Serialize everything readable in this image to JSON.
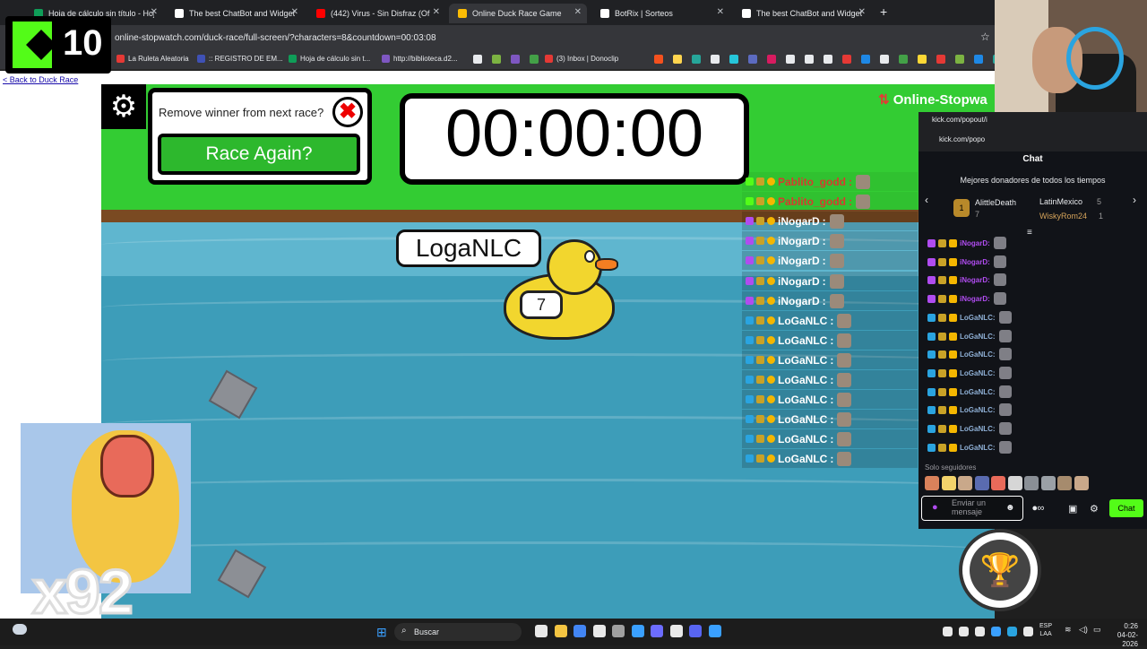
{
  "browser": {
    "tabs": [
      {
        "label": "Hoja de cálculo sin título - Hoja",
        "color": "#0f9d58",
        "active": false
      },
      {
        "label": "The best ChatBot and Widgets",
        "color": "#ffffff",
        "active": false
      },
      {
        "label": "(442) Virus - Sin Disfraz (Of",
        "color": "#ff0000",
        "active": false
      },
      {
        "label": "Online Duck Race Game",
        "color": "#fbbc04",
        "active": true
      },
      {
        "label": "BotRix | Sorteos",
        "color": "#ffffff",
        "active": false
      },
      {
        "label": "The best ChatBot and Widgets",
        "color": "#ffffff",
        "active": false
      }
    ],
    "new_tab": "+",
    "url": "online-stopwatch.com/duck-race/full-screen/?characters=8&countdown=00:03:08",
    "star": "☆",
    "bookmarks": [
      {
        "label": "La Ruleta Aleatoria",
        "color": "#e53935"
      },
      {
        "label": ":: REGISTRO DE EM...",
        "color": "#3f51b5"
      },
      {
        "label": "Hoja de cálculo sin t...",
        "color": "#0f9d58"
      },
      {
        "label": "http://biblioteca.d2...",
        "color": "#7e57c2"
      },
      {
        "label": "(3) Inbox | Donoclip",
        "color": "#e53935"
      }
    ]
  },
  "overlay": {
    "kick_number": "10",
    "multiplier": "x92"
  },
  "page": {
    "back_link": "< Back to Duck Race"
  },
  "race": {
    "remove_winner_label": "Remove winner from next race?",
    "close_icon": "✖",
    "race_again_label": "Race Again?",
    "timer": "00:00:00",
    "brand": "Online-Stopwa",
    "duck_name": "LogaNLC",
    "duck_number": "7",
    "leaderboard": [
      {
        "name": "Pablito_godd",
        "badge": "#53fc18",
        "first": true
      },
      {
        "name": "Pablito_godd",
        "badge": "#53fc18",
        "first": true
      },
      {
        "name": "iNogarD",
        "badge": "#b04cf0",
        "first": false
      },
      {
        "name": "iNogarD",
        "badge": "#b04cf0",
        "first": false
      },
      {
        "name": "iNogarD",
        "badge": "#b04cf0",
        "first": false
      },
      {
        "name": "iNogarD",
        "badge": "#b04cf0",
        "first": false
      },
      {
        "name": "iNogarD",
        "badge": "#b04cf0",
        "first": false
      },
      {
        "name": "LoGaNLC",
        "badge": "#2aa4e0",
        "first": false
      },
      {
        "name": "LoGaNLC",
        "badge": "#2aa4e0",
        "first": false
      },
      {
        "name": "LoGaNLC",
        "badge": "#2aa4e0",
        "first": false
      },
      {
        "name": "LoGaNLC",
        "badge": "#2aa4e0",
        "first": false
      },
      {
        "name": "LoGaNLC",
        "badge": "#2aa4e0",
        "first": false
      },
      {
        "name": "LoGaNLC",
        "badge": "#2aa4e0",
        "first": false
      },
      {
        "name": "LoGaNLC",
        "badge": "#2aa4e0",
        "first": false
      },
      {
        "name": "LoGaNLC",
        "badge": "#2aa4e0",
        "first": false
      }
    ],
    "name_suffix": ":"
  },
  "chat": {
    "url_1": "kick.com/popout/i",
    "url_2": "kick.com/popo",
    "title": "Chat",
    "donors_title": "Mejores donadores de todos los tiempos",
    "donors": [
      {
        "name": "AlittleDeath",
        "count": "7"
      },
      {
        "name": "LatinMexico",
        "count": "5"
      },
      {
        "name": "WiskyRom24",
        "count": "1"
      }
    ],
    "top_rank": "1",
    "messages": [
      {
        "name": "iNogarD:",
        "color": "#b04cf0"
      },
      {
        "name": "iNogarD:",
        "color": "#b04cf0"
      },
      {
        "name": "iNogarD:",
        "color": "#b04cf0"
      },
      {
        "name": "iNogarD:",
        "color": "#b04cf0"
      },
      {
        "name": "LoGaNLC:",
        "color": "#8fb0d6"
      },
      {
        "name": "LoGaNLC:",
        "color": "#8fb0d6"
      },
      {
        "name": "LoGaNLC:",
        "color": "#8fb0d6"
      },
      {
        "name": "LoGaNLC:",
        "color": "#8fb0d6"
      },
      {
        "name": "LoGaNLC:",
        "color": "#8fb0d6"
      },
      {
        "name": "LoGaNLC:",
        "color": "#8fb0d6"
      },
      {
        "name": "LoGaNLC:",
        "color": "#8fb0d6"
      },
      {
        "name": "LoGaNLC:",
        "color": "#8fb0d6"
      }
    ],
    "followers_only": "Solo seguidores",
    "input_placeholder": "Enviar un mensaje",
    "send_label": "Chat"
  },
  "taskbar": {
    "search_label": "Buscar",
    "lang_line1": "ESP",
    "lang_line2": "LAA",
    "time": "0:26",
    "date": "04-02-2026"
  }
}
